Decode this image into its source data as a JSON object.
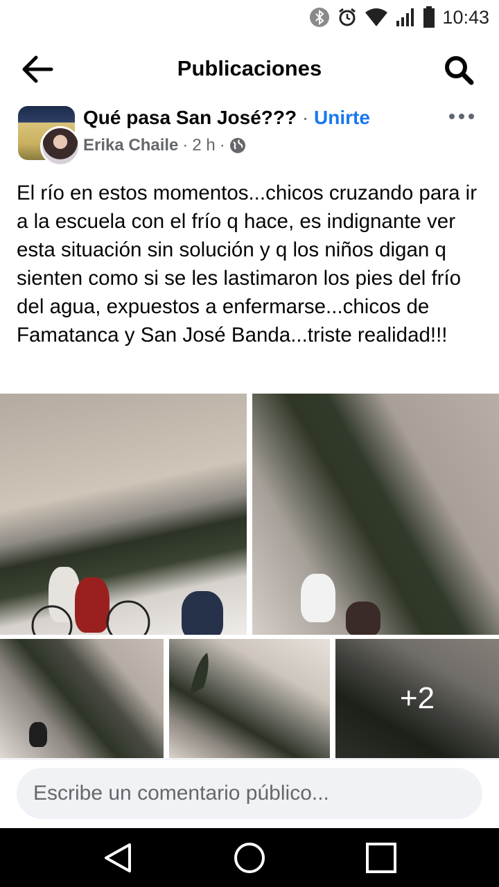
{
  "status_bar": {
    "time": "10:43",
    "icons": [
      "bluetooth-icon",
      "alarm-icon",
      "wifi-icon",
      "signal-icon",
      "battery-icon"
    ]
  },
  "app_bar": {
    "title": "Publicaciones",
    "back_icon": "arrow-left-icon",
    "search_icon": "search-icon"
  },
  "post": {
    "group_name": "Qué pasa San José???",
    "separator": "·",
    "join_label": "Unirte",
    "author": "Erika Chaile",
    "time": "2 h",
    "privacy_icon": "globe-icon",
    "more_icon": "more-horizontal-icon",
    "text": "El río en estos momentos...chicos cruzando para ir a la escuela con el frío q hace, es indignante ver esta situación sin solución y q los niños digan q sienten como si se les lastimaron los pies del frío del agua, expuestos a enfermarse...chicos de Famatanca y San José Banda...triste realidad!!!",
    "extra_photos_label": "+2"
  },
  "comment": {
    "placeholder": "Escribe un comentario público..."
  },
  "nav": {
    "icons": [
      "back-triangle-icon",
      "home-circle-icon",
      "recents-square-icon"
    ]
  },
  "colors": {
    "link": "#1877f2",
    "secondary_text": "#65676b",
    "comment_bg": "#f0f2f5"
  }
}
